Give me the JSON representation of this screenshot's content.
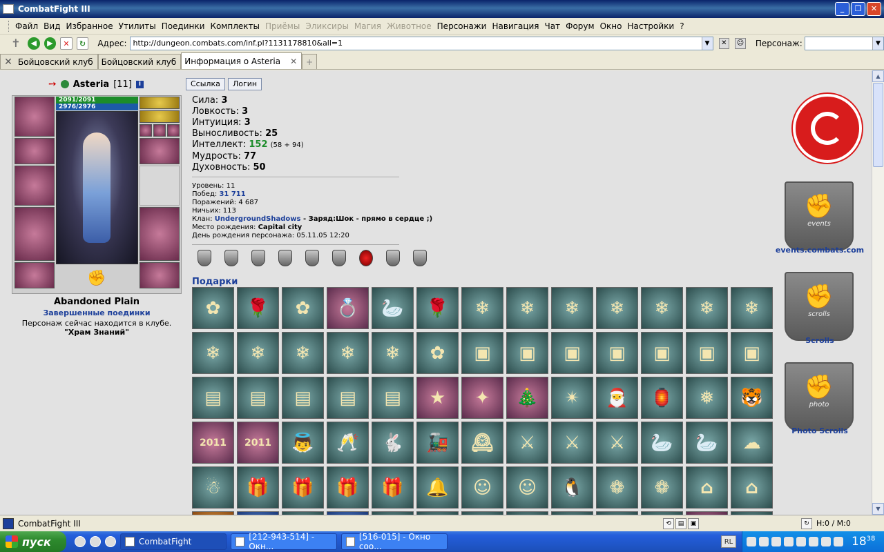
{
  "window": {
    "title": "CombatFight III",
    "controls": {
      "minimize": "_",
      "maximize": "❐",
      "close": "✕"
    }
  },
  "menu": {
    "items": [
      {
        "label": "Файл",
        "disabled": false
      },
      {
        "label": "Вид",
        "disabled": false
      },
      {
        "label": "Избранное",
        "disabled": false
      },
      {
        "label": "Утилиты",
        "disabled": false
      },
      {
        "label": "Поединки",
        "disabled": false
      },
      {
        "label": "Комплекты",
        "disabled": false
      },
      {
        "label": "Приёмы",
        "disabled": true
      },
      {
        "label": "Эликсиры",
        "disabled": true
      },
      {
        "label": "Магия",
        "disabled": true
      },
      {
        "label": "Животное",
        "disabled": true
      },
      {
        "label": "Персонажи",
        "disabled": false
      },
      {
        "label": "Навигация",
        "disabled": false
      },
      {
        "label": "Чат",
        "disabled": false
      },
      {
        "label": "Форум",
        "disabled": false
      },
      {
        "label": "Окно",
        "disabled": false
      },
      {
        "label": "Настройки",
        "disabled": false
      },
      {
        "label": "?",
        "disabled": false
      }
    ]
  },
  "addressbar": {
    "label": "Адрес:",
    "url": "http://dungeon.combats.com/inf.pl?1131178810&all=1",
    "persona_label": "Персонаж:",
    "persona_value": ""
  },
  "tabs": [
    {
      "label": "Бойцовский клуб",
      "icon": "crossed-swords-icon",
      "active": false
    },
    {
      "label": "Бойцовский клуб",
      "icon": "info-icon",
      "active": false
    },
    {
      "label": "Информация о Asteria",
      "icon": "info-icon",
      "active": true
    }
  ],
  "character": {
    "name": "Asteria",
    "level_badge": "[11]",
    "hp": "2091/2091",
    "mana": "2976/2976",
    "location": "Abandoned Plain",
    "finished_fights": "Завершенные поединки",
    "status": "Персонаж сейчас находится в клубе.",
    "room": "\"Храм Знаний\""
  },
  "buttons": {
    "link": "Ссылка",
    "login": "Логин"
  },
  "stats": [
    {
      "label": "Сила:",
      "value": "3",
      "extra": ""
    },
    {
      "label": "Ловкость:",
      "value": "3",
      "extra": ""
    },
    {
      "label": "Интуиция:",
      "value": "3",
      "extra": ""
    },
    {
      "label": "Выносливость:",
      "value": "25",
      "extra": ""
    },
    {
      "label": "Интеллект:",
      "value": "152",
      "extra": "(58 + 94)"
    },
    {
      "label": "Мудрость:",
      "value": "77",
      "extra": ""
    },
    {
      "label": "Духовность:",
      "value": "50",
      "extra": ""
    }
  ],
  "info": {
    "level_label": "Уровень:",
    "level": "11",
    "wins_label": "Побед:",
    "wins": "31 711",
    "losses_label": "Поражений:",
    "losses": "4 687",
    "draws_label": "Ничьих:",
    "draws": "113",
    "clan_label": "Клан:",
    "clan": "UndergroundShadows",
    "clan_motto": " - Заряд:Шок - прямо в сердце ;)",
    "birthplace_label": "Место рождения:",
    "birthplace": "Capital city",
    "birthday_label": "День рождения персонажа:",
    "birthday": "05.11.05 12:20"
  },
  "gifts_title": "Подарки",
  "gifts": [
    {
      "icon": "orchid-icon",
      "glyph": "✿",
      "bg": "teal"
    },
    {
      "icon": "golden-rose-icon",
      "glyph": "🌹",
      "bg": "teal"
    },
    {
      "icon": "orchid-icon",
      "glyph": "✿",
      "bg": "teal"
    },
    {
      "icon": "ring-icon",
      "glyph": "💍",
      "bg": "pink"
    },
    {
      "icon": "swans-icon",
      "glyph": "🦢",
      "bg": "teal"
    },
    {
      "icon": "golden-rose-icon",
      "glyph": "🌹",
      "bg": "teal"
    },
    {
      "icon": "ice-crystal-icon",
      "glyph": "❄",
      "bg": "teal"
    },
    {
      "icon": "ice-crystal-icon",
      "glyph": "❄",
      "bg": "teal"
    },
    {
      "icon": "ice-crystal-icon",
      "glyph": "❄",
      "bg": "teal"
    },
    {
      "icon": "ice-crystal-icon",
      "glyph": "❄",
      "bg": "teal"
    },
    {
      "icon": "ice-crystal-icon",
      "glyph": "❄",
      "bg": "teal"
    },
    {
      "icon": "ice-crystal-icon",
      "glyph": "❄",
      "bg": "teal"
    },
    {
      "icon": "ice-crystal-icon",
      "glyph": "❄",
      "bg": "teal"
    },
    {
      "icon": "ice-crystal-icon",
      "glyph": "❄",
      "bg": "teal"
    },
    {
      "icon": "ice-crystal-icon",
      "glyph": "❄",
      "bg": "teal"
    },
    {
      "icon": "ice-crystal-icon",
      "glyph": "❄",
      "bg": "teal"
    },
    {
      "icon": "ice-crystal-icon",
      "glyph": "❄",
      "bg": "teal"
    },
    {
      "icon": "ice-crystal-icon",
      "glyph": "❄",
      "bg": "teal"
    },
    {
      "icon": "orchid-icon",
      "glyph": "✿",
      "bg": "teal"
    },
    {
      "icon": "chest-icon",
      "glyph": "▣",
      "bg": "teal"
    },
    {
      "icon": "chest-icon",
      "glyph": "▣",
      "bg": "teal"
    },
    {
      "icon": "chest-icon",
      "glyph": "▣",
      "bg": "teal"
    },
    {
      "icon": "chest-icon",
      "glyph": "▣",
      "bg": "teal"
    },
    {
      "icon": "chest-icon",
      "glyph": "▣",
      "bg": "teal"
    },
    {
      "icon": "chest-icon",
      "glyph": "▣",
      "bg": "teal"
    },
    {
      "icon": "chest-icon",
      "glyph": "▣",
      "bg": "teal"
    },
    {
      "icon": "green-box-icon",
      "glyph": "▤",
      "bg": "teal"
    },
    {
      "icon": "blue-box-icon",
      "glyph": "▤",
      "bg": "teal"
    },
    {
      "icon": "navy-box-icon",
      "glyph": "▤",
      "bg": "teal"
    },
    {
      "icon": "purple-box-icon",
      "glyph": "▤",
      "bg": "teal"
    },
    {
      "icon": "gold-box-icon",
      "glyph": "▤",
      "bg": "teal"
    },
    {
      "icon": "star-icon",
      "glyph": "★",
      "bg": "pink"
    },
    {
      "icon": "magic-wand-icon",
      "glyph": "✦",
      "bg": "pink"
    },
    {
      "icon": "christmas-tree-icon",
      "glyph": "🎄",
      "bg": "pink"
    },
    {
      "icon": "sparkler-icon",
      "glyph": "✴",
      "bg": "teal"
    },
    {
      "icon": "santa-icon",
      "glyph": "🎅",
      "bg": "teal"
    },
    {
      "icon": "lantern-icon",
      "glyph": "🏮",
      "bg": "teal"
    },
    {
      "icon": "snowflake-ornament-icon",
      "glyph": "❅",
      "bg": "teal"
    },
    {
      "icon": "white-tiger-icon",
      "glyph": "🐯",
      "bg": "teal"
    },
    {
      "icon": "year-2011-icon",
      "glyph": "2011",
      "bg": "pink"
    },
    {
      "icon": "year-2011-icon",
      "glyph": "2011",
      "bg": "pink"
    },
    {
      "icon": "angel-icon",
      "glyph": "👼",
      "bg": "teal"
    },
    {
      "icon": "champagne-icon",
      "glyph": "🥂",
      "bg": "teal"
    },
    {
      "icon": "rabbit-icon",
      "glyph": "🐇",
      "bg": "teal"
    },
    {
      "icon": "toy-train-icon",
      "glyph": "🚂",
      "bg": "teal"
    },
    {
      "icon": "clock-icon",
      "glyph": "🕰",
      "bg": "teal"
    },
    {
      "icon": "knight-rabbit-icon",
      "glyph": "⚔",
      "bg": "teal"
    },
    {
      "icon": "knight-rabbit-icon",
      "glyph": "⚔",
      "bg": "teal"
    },
    {
      "icon": "knight-rabbit-icon",
      "glyph": "⚔",
      "bg": "teal"
    },
    {
      "icon": "swans-icon",
      "glyph": "🦢",
      "bg": "teal"
    },
    {
      "icon": "swans-icon",
      "glyph": "🦢",
      "bg": "teal"
    },
    {
      "icon": "pink-cake-icon",
      "glyph": "☁",
      "bg": "teal"
    },
    {
      "icon": "snowman-statue-icon",
      "glyph": "☃",
      "bg": "teal"
    },
    {
      "icon": "gift-box-icon",
      "glyph": "🎁",
      "bg": "teal"
    },
    {
      "icon": "gift-box-icon",
      "glyph": "🎁",
      "bg": "teal"
    },
    {
      "icon": "gift-box-icon",
      "glyph": "🎁",
      "bg": "teal"
    },
    {
      "icon": "gift-box-icon",
      "glyph": "🎁",
      "bg": "teal"
    },
    {
      "icon": "bells-icon",
      "glyph": "🔔",
      "bg": "teal"
    },
    {
      "icon": "smiley-icon",
      "glyph": "☺",
      "bg": "teal"
    },
    {
      "icon": "smiley-icon",
      "glyph": "☺",
      "bg": "teal"
    },
    {
      "icon": "penguin-icon",
      "glyph": "🐧",
      "bg": "teal"
    },
    {
      "icon": "cabbage-icon",
      "glyph": "❁",
      "bg": "teal"
    },
    {
      "icon": "cabbage-icon",
      "glyph": "❁",
      "bg": "teal"
    },
    {
      "icon": "snow-house-icon",
      "glyph": "⌂",
      "bg": "teal"
    },
    {
      "icon": "snow-house-icon",
      "glyph": "⌂",
      "bg": "teal"
    },
    {
      "icon": "partial-gift-icon",
      "glyph": "",
      "bg": "orange"
    },
    {
      "icon": "partial-gift-icon",
      "glyph": "",
      "bg": "blue"
    },
    {
      "icon": "partial-gift-icon",
      "glyph": "",
      "bg": "teal"
    },
    {
      "icon": "partial-gift-icon",
      "glyph": "",
      "bg": "blue"
    },
    {
      "icon": "partial-gift-icon",
      "glyph": "",
      "bg": "teal"
    },
    {
      "icon": "partial-gift-icon",
      "glyph": "",
      "bg": "teal"
    },
    {
      "icon": "partial-gift-icon",
      "glyph": "",
      "bg": "teal"
    },
    {
      "icon": "partial-gift-icon",
      "glyph": "",
      "bg": "teal"
    },
    {
      "icon": "partial-gift-icon",
      "glyph": "",
      "bg": "teal"
    },
    {
      "icon": "partial-gift-icon",
      "glyph": "",
      "bg": "teal"
    },
    {
      "icon": "partial-gift-icon",
      "glyph": "",
      "bg": "teal"
    },
    {
      "icon": "partial-gift-icon",
      "glyph": "",
      "bg": "pink"
    },
    {
      "icon": "partial-gift-icon",
      "glyph": "",
      "bg": "teal"
    }
  ],
  "banners": {
    "events_label": "events.combats.com",
    "events_text": "events",
    "scrolls_label": "Scrolls",
    "scrolls_text": "scrolls",
    "photo_label": "Photo Scrolls",
    "photo_text": "photo"
  },
  "statusbar": {
    "text": "CombatFight III",
    "hm": "H:0 / M:0"
  },
  "taskbar": {
    "start": "пуск",
    "tasks": [
      {
        "label": "CombatFight",
        "active": true
      },
      {
        "label": "[212-943-514] - Окн...",
        "active": false
      },
      {
        "label": "[516-015] - Окно соо...",
        "active": false
      }
    ],
    "lang": "RL",
    "clock_h": "18",
    "clock_m": "38"
  }
}
